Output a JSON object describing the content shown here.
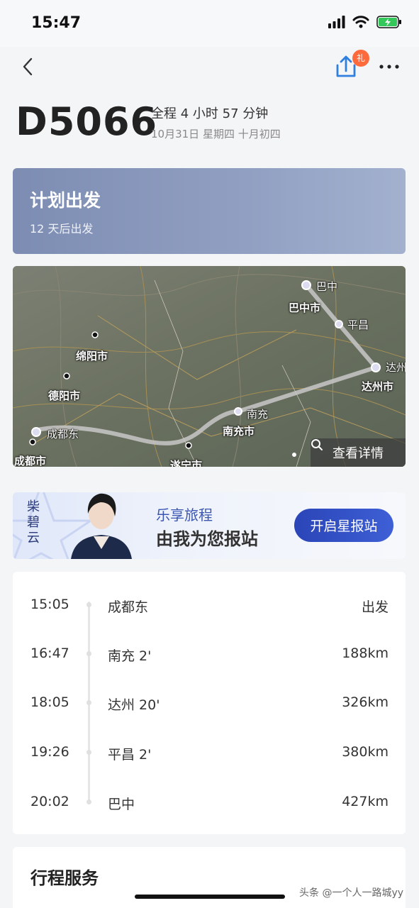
{
  "status_bar": {
    "time": "15:47"
  },
  "header": {
    "gift_badge": "礼"
  },
  "trip": {
    "train_no": "D5066",
    "duration": "全程 4 小时 57 分钟",
    "date": "10月31日  星期四  十月初四"
  },
  "plan": {
    "title": "计划出发",
    "subtitle": "12 天后出发"
  },
  "map": {
    "labels": {
      "bazhong": "巴中",
      "bazhong_city": "巴中市",
      "pingchang": "平昌",
      "mianyang_city": "绵阳市",
      "deyang_city": "德阳市",
      "dazhou": "达州",
      "dazhou_city": "达州市",
      "nanchong": "南充",
      "nanchong_city": "南充市",
      "chengdudong": "成都东",
      "chengdu_city": "成都市",
      "suining_city": "遂宁市"
    },
    "detail_button": "查看详情"
  },
  "promo": {
    "name": "柴碧云",
    "line1": "乐享旅程",
    "line2": "由我为您报站",
    "button": "开启星报站"
  },
  "stops": [
    {
      "time": "15:05",
      "station": "成都东",
      "info": "出发"
    },
    {
      "time": "16:47",
      "station": "南充 2'",
      "info": "188km"
    },
    {
      "time": "18:05",
      "station": "达州 20'",
      "info": "326km"
    },
    {
      "time": "19:26",
      "station": "平昌 2'",
      "info": "380km"
    },
    {
      "time": "20:02",
      "station": "巴中",
      "info": "427km"
    }
  ],
  "service": {
    "title": "行程服务"
  },
  "watermark": "头条 @一个人一路城yy",
  "colors": {
    "accent": "#2a45b7",
    "plan_card": "#8a99bd",
    "badge": "#ff6a3d"
  }
}
